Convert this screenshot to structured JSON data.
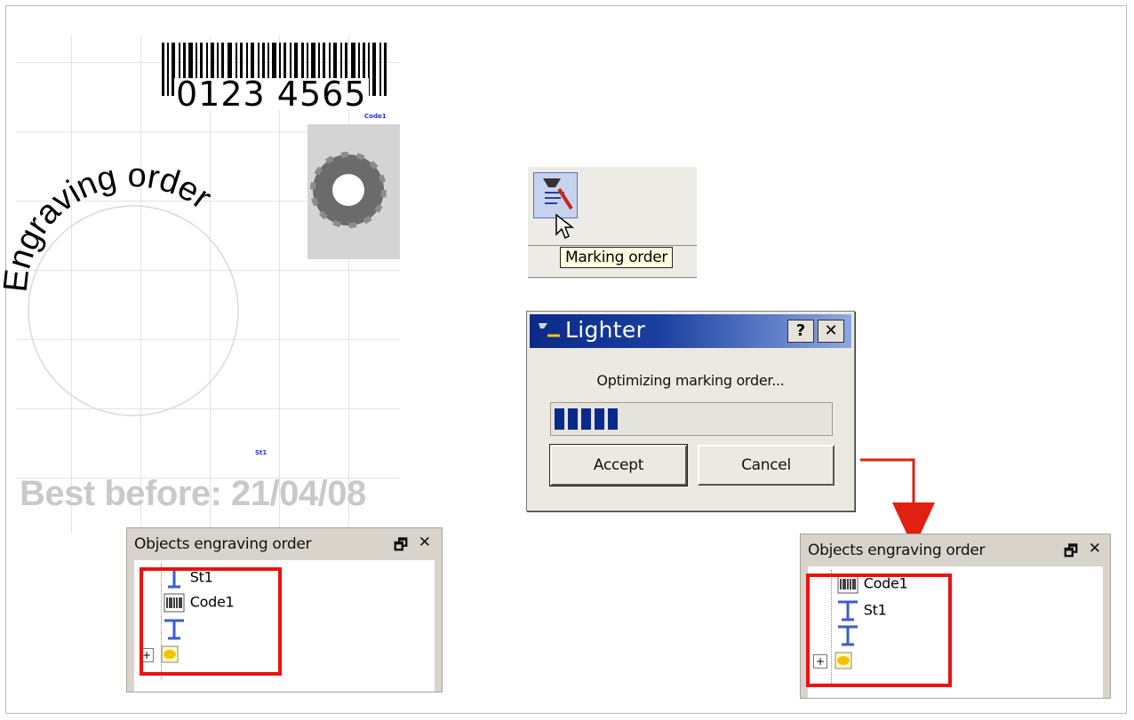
{
  "canvas": {
    "barcode_digits": "0123 4565",
    "barcode_tag": "Code1",
    "arc_text": "Engraving order",
    "text_tag": "St1",
    "best_before": "Best before: 21/04/08"
  },
  "panel_before": {
    "title": "Objects engraving order",
    "restore_icon": "restore-icon",
    "close_icon": "close-icon",
    "items": [
      {
        "label": "St1",
        "icon": "text-object-icon"
      },
      {
        "label": "Code1",
        "icon": "barcode-object-icon"
      },
      {
        "label": "",
        "icon": "image-object-icon"
      }
    ]
  },
  "toolbar": {
    "tool_icon": "marking-order-icon",
    "tooltip": "Marking order"
  },
  "dialog": {
    "title": "Lighter",
    "help_label": "?",
    "close_label": "✕",
    "message": "Optimizing marking order...",
    "progress": 0.25,
    "accept_label": "Accept",
    "cancel_label": "Cancel"
  },
  "panel_after": {
    "title": "Objects engraving order",
    "restore_icon": "restore-icon",
    "close_icon": "close-icon",
    "items": [
      {
        "label": "Code1",
        "icon": "barcode-object-icon"
      },
      {
        "label": "St1",
        "icon": "text-object-icon"
      },
      {
        "label": "",
        "icon": "image-object-icon"
      }
    ]
  },
  "colors": {
    "highlight": "#ee1111",
    "dialog_title": "#0b2a86",
    "progress": "#0a2a8a",
    "arrow": "#e02010"
  }
}
